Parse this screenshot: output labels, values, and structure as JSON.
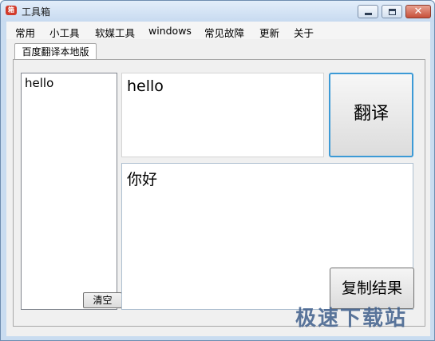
{
  "window": {
    "title": "工具箱",
    "app_icon": "toolbox-icon"
  },
  "menu": {
    "items": [
      "常用",
      "小工具",
      "软媒工具",
      "windows",
      "常见故障",
      "更新",
      "关于"
    ]
  },
  "tabs": [
    {
      "label": "百度翻译本地版",
      "active": true
    }
  ],
  "history_list": {
    "items": [
      "hello"
    ],
    "clear_label": "清空"
  },
  "input": {
    "value": "hello"
  },
  "translate_button": {
    "label": "翻译"
  },
  "output": {
    "value": "你好"
  },
  "copy_button": {
    "label": "复制结果"
  },
  "watermark": {
    "text": "极速下载站"
  },
  "colors": {
    "focus_border": "#3c9ad6",
    "title_bar": "#c7daf0",
    "close_button": "#c7503a"
  }
}
